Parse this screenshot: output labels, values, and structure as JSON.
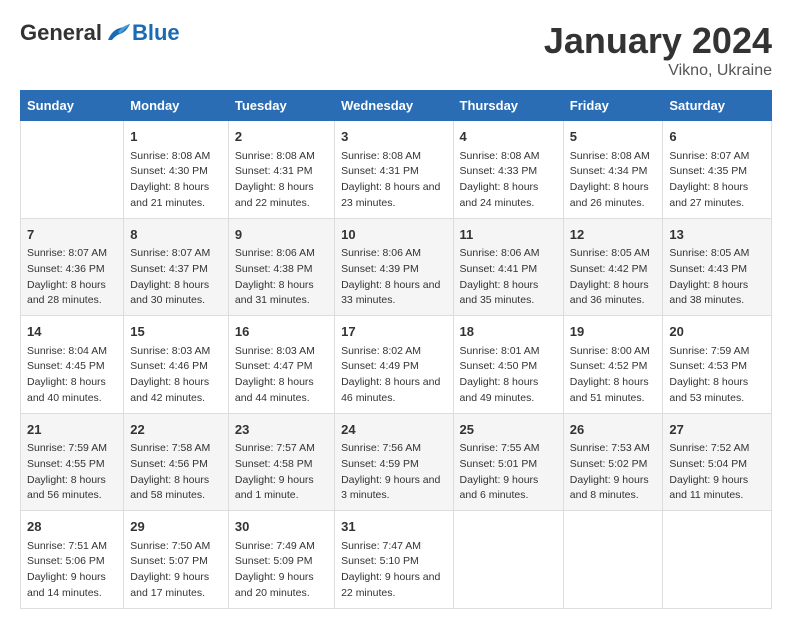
{
  "header": {
    "logo": {
      "general": "General",
      "blue": "Blue"
    },
    "title": "January 2024",
    "subtitle": "Vikno, Ukraine"
  },
  "calendar": {
    "days_of_week": [
      "Sunday",
      "Monday",
      "Tuesday",
      "Wednesday",
      "Thursday",
      "Friday",
      "Saturday"
    ],
    "weeks": [
      [
        {
          "day": "",
          "sunrise": "",
          "sunset": "",
          "daylight": ""
        },
        {
          "day": "1",
          "sunrise": "Sunrise: 8:08 AM",
          "sunset": "Sunset: 4:30 PM",
          "daylight": "Daylight: 8 hours and 21 minutes."
        },
        {
          "day": "2",
          "sunrise": "Sunrise: 8:08 AM",
          "sunset": "Sunset: 4:31 PM",
          "daylight": "Daylight: 8 hours and 22 minutes."
        },
        {
          "day": "3",
          "sunrise": "Sunrise: 8:08 AM",
          "sunset": "Sunset: 4:31 PM",
          "daylight": "Daylight: 8 hours and 23 minutes."
        },
        {
          "day": "4",
          "sunrise": "Sunrise: 8:08 AM",
          "sunset": "Sunset: 4:33 PM",
          "daylight": "Daylight: 8 hours and 24 minutes."
        },
        {
          "day": "5",
          "sunrise": "Sunrise: 8:08 AM",
          "sunset": "Sunset: 4:34 PM",
          "daylight": "Daylight: 8 hours and 26 minutes."
        },
        {
          "day": "6",
          "sunrise": "Sunrise: 8:07 AM",
          "sunset": "Sunset: 4:35 PM",
          "daylight": "Daylight: 8 hours and 27 minutes."
        }
      ],
      [
        {
          "day": "7",
          "sunrise": "Sunrise: 8:07 AM",
          "sunset": "Sunset: 4:36 PM",
          "daylight": "Daylight: 8 hours and 28 minutes."
        },
        {
          "day": "8",
          "sunrise": "Sunrise: 8:07 AM",
          "sunset": "Sunset: 4:37 PM",
          "daylight": "Daylight: 8 hours and 30 minutes."
        },
        {
          "day": "9",
          "sunrise": "Sunrise: 8:06 AM",
          "sunset": "Sunset: 4:38 PM",
          "daylight": "Daylight: 8 hours and 31 minutes."
        },
        {
          "day": "10",
          "sunrise": "Sunrise: 8:06 AM",
          "sunset": "Sunset: 4:39 PM",
          "daylight": "Daylight: 8 hours and 33 minutes."
        },
        {
          "day": "11",
          "sunrise": "Sunrise: 8:06 AM",
          "sunset": "Sunset: 4:41 PM",
          "daylight": "Daylight: 8 hours and 35 minutes."
        },
        {
          "day": "12",
          "sunrise": "Sunrise: 8:05 AM",
          "sunset": "Sunset: 4:42 PM",
          "daylight": "Daylight: 8 hours and 36 minutes."
        },
        {
          "day": "13",
          "sunrise": "Sunrise: 8:05 AM",
          "sunset": "Sunset: 4:43 PM",
          "daylight": "Daylight: 8 hours and 38 minutes."
        }
      ],
      [
        {
          "day": "14",
          "sunrise": "Sunrise: 8:04 AM",
          "sunset": "Sunset: 4:45 PM",
          "daylight": "Daylight: 8 hours and 40 minutes."
        },
        {
          "day": "15",
          "sunrise": "Sunrise: 8:03 AM",
          "sunset": "Sunset: 4:46 PM",
          "daylight": "Daylight: 8 hours and 42 minutes."
        },
        {
          "day": "16",
          "sunrise": "Sunrise: 8:03 AM",
          "sunset": "Sunset: 4:47 PM",
          "daylight": "Daylight: 8 hours and 44 minutes."
        },
        {
          "day": "17",
          "sunrise": "Sunrise: 8:02 AM",
          "sunset": "Sunset: 4:49 PM",
          "daylight": "Daylight: 8 hours and 46 minutes."
        },
        {
          "day": "18",
          "sunrise": "Sunrise: 8:01 AM",
          "sunset": "Sunset: 4:50 PM",
          "daylight": "Daylight: 8 hours and 49 minutes."
        },
        {
          "day": "19",
          "sunrise": "Sunrise: 8:00 AM",
          "sunset": "Sunset: 4:52 PM",
          "daylight": "Daylight: 8 hours and 51 minutes."
        },
        {
          "day": "20",
          "sunrise": "Sunrise: 7:59 AM",
          "sunset": "Sunset: 4:53 PM",
          "daylight": "Daylight: 8 hours and 53 minutes."
        }
      ],
      [
        {
          "day": "21",
          "sunrise": "Sunrise: 7:59 AM",
          "sunset": "Sunset: 4:55 PM",
          "daylight": "Daylight: 8 hours and 56 minutes."
        },
        {
          "day": "22",
          "sunrise": "Sunrise: 7:58 AM",
          "sunset": "Sunset: 4:56 PM",
          "daylight": "Daylight: 8 hours and 58 minutes."
        },
        {
          "day": "23",
          "sunrise": "Sunrise: 7:57 AM",
          "sunset": "Sunset: 4:58 PM",
          "daylight": "Daylight: 9 hours and 1 minute."
        },
        {
          "day": "24",
          "sunrise": "Sunrise: 7:56 AM",
          "sunset": "Sunset: 4:59 PM",
          "daylight": "Daylight: 9 hours and 3 minutes."
        },
        {
          "day": "25",
          "sunrise": "Sunrise: 7:55 AM",
          "sunset": "Sunset: 5:01 PM",
          "daylight": "Daylight: 9 hours and 6 minutes."
        },
        {
          "day": "26",
          "sunrise": "Sunrise: 7:53 AM",
          "sunset": "Sunset: 5:02 PM",
          "daylight": "Daylight: 9 hours and 8 minutes."
        },
        {
          "day": "27",
          "sunrise": "Sunrise: 7:52 AM",
          "sunset": "Sunset: 5:04 PM",
          "daylight": "Daylight: 9 hours and 11 minutes."
        }
      ],
      [
        {
          "day": "28",
          "sunrise": "Sunrise: 7:51 AM",
          "sunset": "Sunset: 5:06 PM",
          "daylight": "Daylight: 9 hours and 14 minutes."
        },
        {
          "day": "29",
          "sunrise": "Sunrise: 7:50 AM",
          "sunset": "Sunset: 5:07 PM",
          "daylight": "Daylight: 9 hours and 17 minutes."
        },
        {
          "day": "30",
          "sunrise": "Sunrise: 7:49 AM",
          "sunset": "Sunset: 5:09 PM",
          "daylight": "Daylight: 9 hours and 20 minutes."
        },
        {
          "day": "31",
          "sunrise": "Sunrise: 7:47 AM",
          "sunset": "Sunset: 5:10 PM",
          "daylight": "Daylight: 9 hours and 22 minutes."
        },
        {
          "day": "",
          "sunrise": "",
          "sunset": "",
          "daylight": ""
        },
        {
          "day": "",
          "sunrise": "",
          "sunset": "",
          "daylight": ""
        },
        {
          "day": "",
          "sunrise": "",
          "sunset": "",
          "daylight": ""
        }
      ]
    ]
  }
}
